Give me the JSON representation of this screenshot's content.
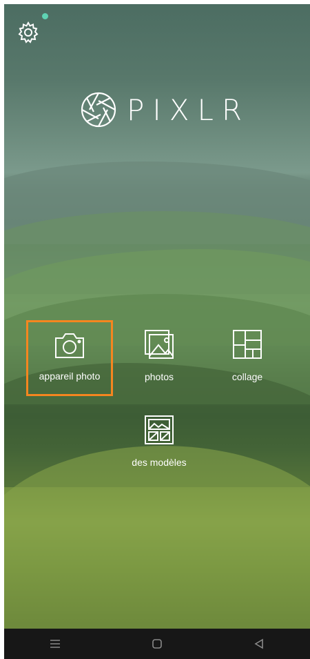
{
  "app": {
    "brand": "PIXLR"
  },
  "tiles": [
    {
      "label": "appareil photo",
      "icon": "camera-icon"
    },
    {
      "label": "photos",
      "icon": "photos-icon"
    },
    {
      "label": "collage",
      "icon": "collage-icon"
    },
    {
      "label": "des modèles",
      "icon": "templates-icon"
    }
  ],
  "colors": {
    "accent_highlight": "#f5861f",
    "notification_dot": "#5fd3b3",
    "navbar": "#171717"
  },
  "navbar": {
    "icons": [
      "menu-icon",
      "home-icon",
      "back-icon"
    ]
  }
}
